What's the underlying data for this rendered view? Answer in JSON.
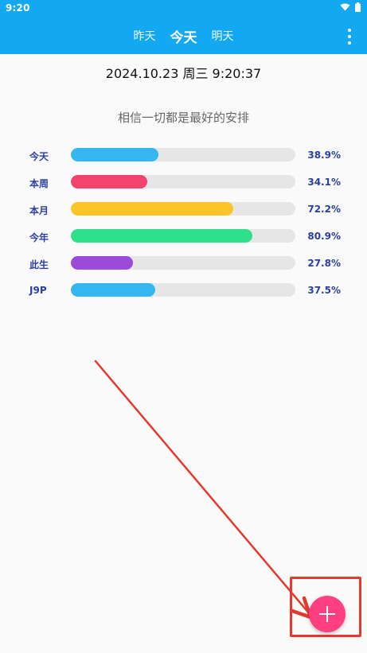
{
  "status_bar": {
    "time": "9:20",
    "icons": [
      "wifi-icon",
      "battery-icon"
    ]
  },
  "tabs": [
    {
      "label": "昨天",
      "active": false
    },
    {
      "label": "今天",
      "active": true
    },
    {
      "label": "明天",
      "active": false
    }
  ],
  "datetime": "2024.10.23 周三 9:20:37",
  "quote": "相信一切都是最好的安排",
  "progress": [
    {
      "label": "今天",
      "value_text": "38.9%",
      "value": 38.9,
      "color": "#34b6f1"
    },
    {
      "label": "本周",
      "value_text": "34.1%",
      "value": 34.1,
      "color": "#f2426e"
    },
    {
      "label": "本月",
      "value_text": "72.2%",
      "value": 72.2,
      "color": "#fbc52a"
    },
    {
      "label": "今年",
      "value_text": "80.9%",
      "value": 80.9,
      "color": "#2fe08a"
    },
    {
      "label": "此生",
      "value_text": "27.8%",
      "value": 27.8,
      "color": "#9b4ad9"
    },
    {
      "label": "J9P",
      "value_text": "37.5%",
      "value": 37.5,
      "color": "#34b6f1"
    }
  ],
  "colors": {
    "appbar": "#13a9f2",
    "fab": "#ff3f7f",
    "label_text": "#2b3fa3",
    "annotation": "#e23b2e"
  },
  "fab": {
    "icon": "plus-icon"
  }
}
